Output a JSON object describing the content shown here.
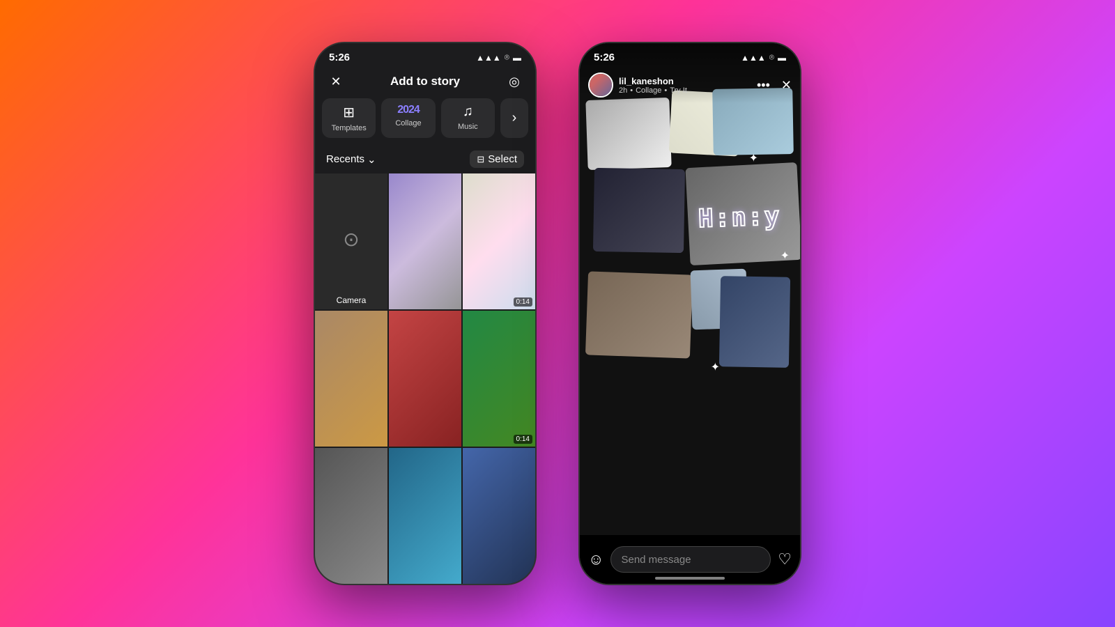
{
  "background": {
    "gradient": "linear-gradient(135deg, #ff6b00 0%, #ff3399 40%, #cc44ff 70%, #8844ff 100%)"
  },
  "phone1": {
    "status": {
      "time": "5:26",
      "icons": "●●● ▲ ▬"
    },
    "header": {
      "close_label": "✕",
      "title": "Add to story",
      "profile_icon": "◎"
    },
    "tabs": [
      {
        "id": "templates",
        "icon": "⊞",
        "label": "Templates"
      },
      {
        "id": "collage",
        "icon": "2024",
        "label": "Collage"
      },
      {
        "id": "music",
        "icon": "♫",
        "label": "Music"
      },
      {
        "id": "more",
        "icon": "›",
        "label": ""
      }
    ],
    "recents": {
      "label": "Recents",
      "chevron": "⌄",
      "select_icon": "⊟",
      "select_label": "Select"
    },
    "camera": {
      "icon": "📷",
      "label": "Camera"
    },
    "grid_photos": [
      {
        "id": "p1",
        "class": "photo-p1",
        "duration": ""
      },
      {
        "id": "p2",
        "class": "photo-p2",
        "duration": "0:14"
      },
      {
        "id": "p3",
        "class": "photo-p3",
        "duration": ""
      },
      {
        "id": "p4",
        "class": "photo-p4",
        "duration": ""
      },
      {
        "id": "p5",
        "class": "photo-p5",
        "duration": ""
      },
      {
        "id": "p6",
        "class": "photo-p6",
        "duration": "0:14"
      },
      {
        "id": "p7",
        "class": "photo-p7",
        "duration": ""
      },
      {
        "id": "p8",
        "class": "photo-p8",
        "duration": ""
      },
      {
        "id": "p9",
        "class": "photo-p9",
        "duration": ""
      }
    ]
  },
  "phone2": {
    "status": {
      "time": "5:26",
      "icons": "●●● ▲ ▬"
    },
    "story": {
      "username": "lil_kaneshon",
      "time_ago": "2h",
      "collage_label": "Collage",
      "try_it": "Try It",
      "menu_icon": "•••",
      "close_icon": "✕"
    },
    "time_overlay": "H:n:y",
    "message_bar": {
      "emoji_icon": "☺",
      "placeholder": "Send message",
      "heart_icon": "♡"
    }
  }
}
